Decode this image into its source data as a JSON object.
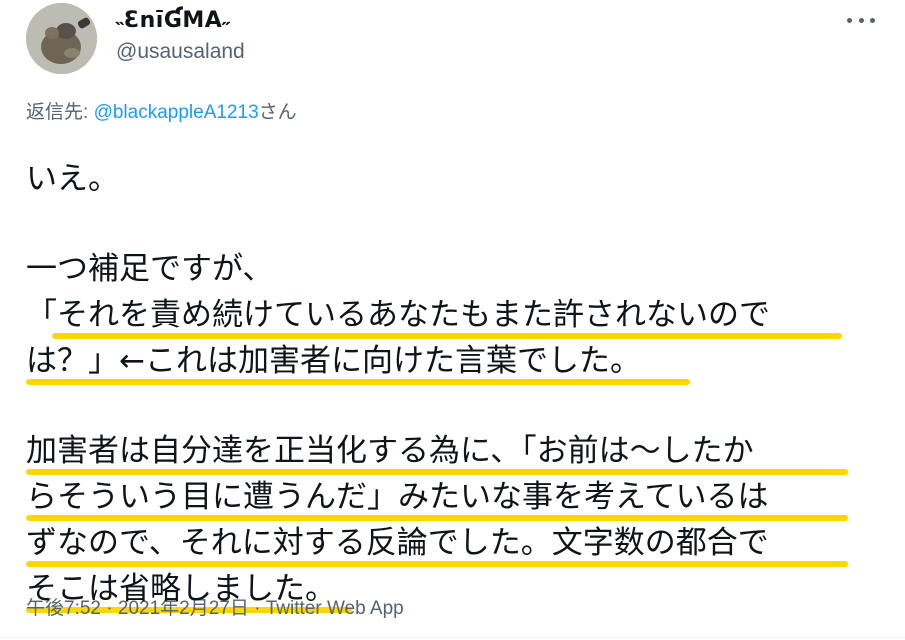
{
  "author": {
    "display_name": "˵ƐnīƓMA˶",
    "handle": "@usausaland"
  },
  "reply": {
    "prefix": "返信先: ",
    "mention": "@blackappleA1213",
    "suffix": "さん"
  },
  "tweet_lines": [
    "いえ。",
    "",
    "一つ補足ですが、",
    "「それを責め続けているあなたもまた許されないので",
    "は？」←これは加害者に向けた言葉でした。",
    "",
    "加害者は自分達を正当化する為に、「お前は〜したか",
    "らそういう目に遭うんだ」みたいな事を考えているは",
    "ずなので、それに対する反論でした。文字数の都合で",
    "そこは省略しました。"
  ],
  "footer": {
    "time": "午後7:52",
    "separator1": " · ",
    "date": "2021年2月27日",
    "separator2": " · ",
    "source": "Twitter Web App"
  },
  "colors": {
    "highlight": "#ffd700",
    "link": "#1d9bf0",
    "secondary_text": "#536471"
  }
}
